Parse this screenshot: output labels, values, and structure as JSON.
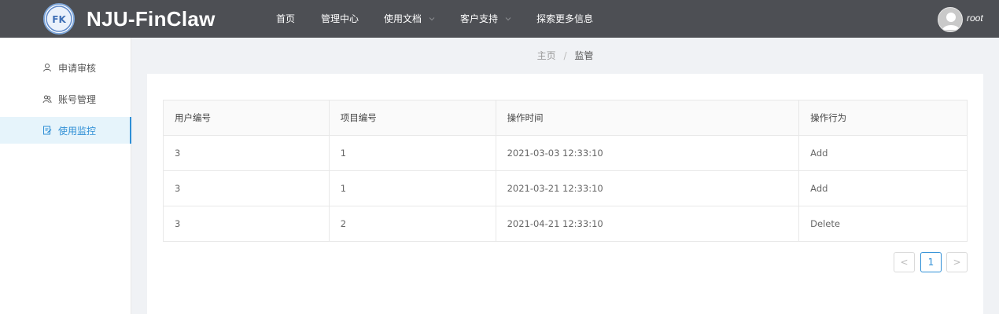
{
  "header": {
    "brand": "NJU-FinClaw",
    "nav": [
      {
        "label": "首页",
        "has_dropdown": false
      },
      {
        "label": "管理中心",
        "has_dropdown": false
      },
      {
        "label": "使用文档",
        "has_dropdown": true
      },
      {
        "label": "客户支持",
        "has_dropdown": true
      },
      {
        "label": "探索更多信息",
        "has_dropdown": false
      }
    ],
    "user": {
      "name": "root",
      "avatar_icon": "user-avatar-icon"
    }
  },
  "sidebar": {
    "items": [
      {
        "label": "申请审核",
        "icon": "user-icon",
        "active": false
      },
      {
        "label": "账号管理",
        "icon": "users-icon",
        "active": false
      },
      {
        "label": "使用监控",
        "icon": "monitor-doc-icon",
        "active": true
      }
    ]
  },
  "breadcrumb": {
    "home": "主页",
    "separator": "/",
    "current": "监管"
  },
  "table": {
    "columns": [
      "用户编号",
      "项目编号",
      "操作时间",
      "操作行为"
    ],
    "rows": [
      [
        "3",
        "1",
        "2021-03-03 12:33:10",
        "Add"
      ],
      [
        "3",
        "1",
        "2021-03-21 12:33:10",
        "Add"
      ],
      [
        "3",
        "2",
        "2021-04-21 12:33:10",
        "Delete"
      ]
    ]
  },
  "pagination": {
    "prev": "<",
    "current_page": "1",
    "next": ">"
  },
  "colors": {
    "header_bg": "#4d4f54",
    "accent": "#2f8fd6",
    "page_bg": "#f0f2f5"
  }
}
